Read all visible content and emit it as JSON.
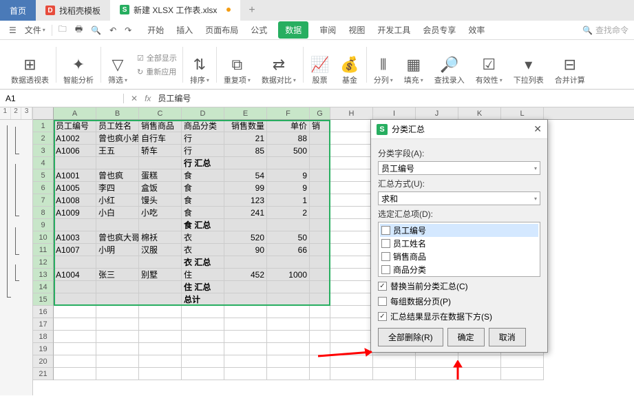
{
  "tabs": {
    "home": "首页",
    "t1": "找稻壳模板",
    "t2": "新建 XLSX 工作表.xlsx"
  },
  "menu": {
    "file": "文件",
    "tabs": [
      "开始",
      "插入",
      "页面布局",
      "公式",
      "数据",
      "审阅",
      "视图",
      "开发工具",
      "会员专享",
      "效率"
    ],
    "active_index": 4,
    "search": "查找命令"
  },
  "ribbon": {
    "pivot": "数据透视表",
    "smart": "智能分析",
    "filter": "筛选",
    "showall": "全部显示",
    "reapply": "重新应用",
    "sort": "排序",
    "dup": "重复项",
    "compare": "数据对比",
    "stock": "股票",
    "fund": "基金",
    "split": "分列",
    "fill": "填充",
    "lookup": "查找录入",
    "valid": "有效性",
    "droplist": "下拉列表",
    "merge": "合并计算"
  },
  "namebox": "A1",
  "formula": "员工编号",
  "outline_levels": [
    "1",
    "2",
    "3"
  ],
  "cols": [
    "A",
    "B",
    "C",
    "D",
    "E",
    "F",
    "G",
    "H",
    "I",
    "J",
    "K",
    "L"
  ],
  "sheet": {
    "r1": {
      "A": "员工编号",
      "B": "员工姓名",
      "C": "销售商品",
      "D": "商品分类",
      "E": "销售数量",
      "F": "单价",
      "G": "销"
    },
    "r2": {
      "A": "A1002",
      "B": "曾也疯小弟",
      "C": "自行车",
      "D": "行",
      "E": "21",
      "F": "88"
    },
    "r3": {
      "A": "A1006",
      "B": "王五",
      "C": "轿车",
      "D": "行",
      "E": "85",
      "F": "500"
    },
    "r4": {
      "D": "行 汇总"
    },
    "r5": {
      "A": "A1001",
      "B": "曾也疯",
      "C": "蛋糕",
      "D": "食",
      "E": "54",
      "F": "9"
    },
    "r6": {
      "A": "A1005",
      "B": "李四",
      "C": "盒饭",
      "D": "食",
      "E": "99",
      "F": "9"
    },
    "r7": {
      "A": "A1008",
      "B": "小红",
      "C": "馒头",
      "D": "食",
      "E": "123",
      "F": "1"
    },
    "r8": {
      "A": "A1009",
      "B": "小白",
      "C": "小吃",
      "D": "食",
      "E": "241",
      "F": "2"
    },
    "r9": {
      "D": "食 汇总"
    },
    "r10": {
      "A": "A1003",
      "B": "曾也疯大哥",
      "C": "棉袄",
      "D": "衣",
      "E": "520",
      "F": "50"
    },
    "r11": {
      "A": "A1007",
      "B": "小明",
      "C": "汉服",
      "D": "衣",
      "E": "90",
      "F": "66"
    },
    "r12": {
      "D": "衣 汇总"
    },
    "r13": {
      "A": "A1004",
      "B": "张三",
      "C": "别墅",
      "D": "住",
      "E": "452",
      "F": "1000"
    },
    "r14": {
      "D": "住 汇总"
    },
    "r15": {
      "D": "总计"
    }
  },
  "dialog": {
    "title": "分类汇总",
    "field_lbl": "分类字段(A):",
    "field_val": "员工编号",
    "func_lbl": "汇总方式(U):",
    "func_val": "求和",
    "items_lbl": "选定汇总项(D):",
    "items": [
      "员工编号",
      "员工姓名",
      "销售商品",
      "商品分类"
    ],
    "chk1": "替换当前分类汇总(C)",
    "chk2": "每组数据分页(P)",
    "chk3": "汇总结果显示在数据下方(S)",
    "btn_removeall": "全部删除(R)",
    "btn_ok": "确定",
    "btn_cancel": "取消"
  }
}
